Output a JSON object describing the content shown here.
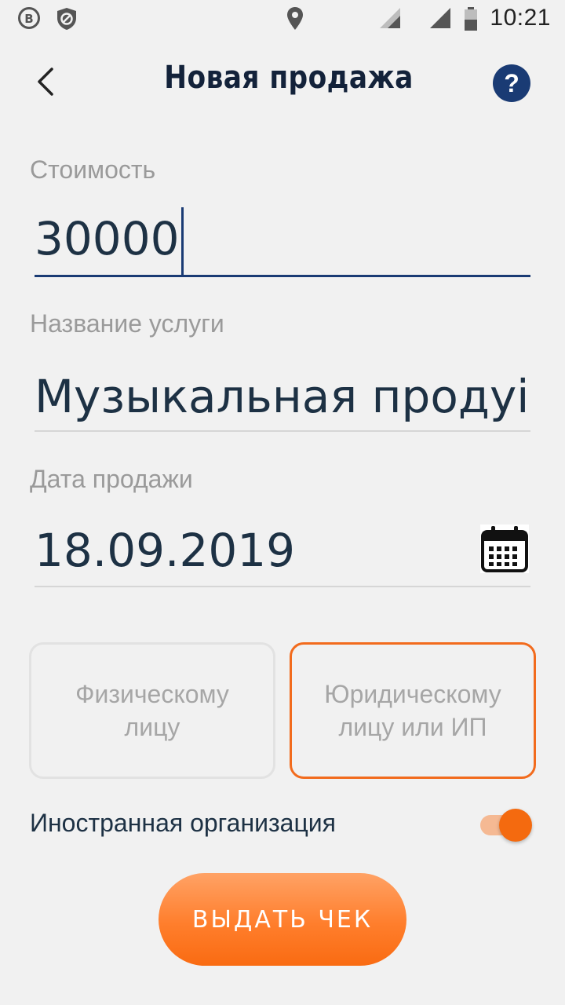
{
  "status_bar": {
    "time": "10:21",
    "icons": [
      "b-messenger-icon",
      "blocked-shield-icon",
      "location-pin-icon",
      "signal-icon",
      "signal-icon",
      "battery-icon"
    ]
  },
  "header": {
    "title": "Новая продажа",
    "help_label": "?"
  },
  "form": {
    "cost": {
      "label": "Стоимость",
      "value": "30000"
    },
    "service": {
      "label": "Название услуги",
      "value": "Музыкальная продуі"
    },
    "date": {
      "label": "Дата продажи",
      "value": "18.09.2019"
    }
  },
  "buyer_type": {
    "physical": [
      "Физическому",
      "лицу"
    ],
    "legal": [
      "Юридическому",
      "лицу или ИП"
    ],
    "selected": "legal"
  },
  "foreign_org": {
    "label": "Иностранная организация",
    "enabled": true
  },
  "submit": {
    "label": "ВЫДАТЬ ЧЕК"
  },
  "colors": {
    "accent": "#f46a0f",
    "primary": "#1a3b74",
    "text": "#1d3144",
    "muted": "#9a9a9a",
    "background": "#f1f1f1"
  }
}
